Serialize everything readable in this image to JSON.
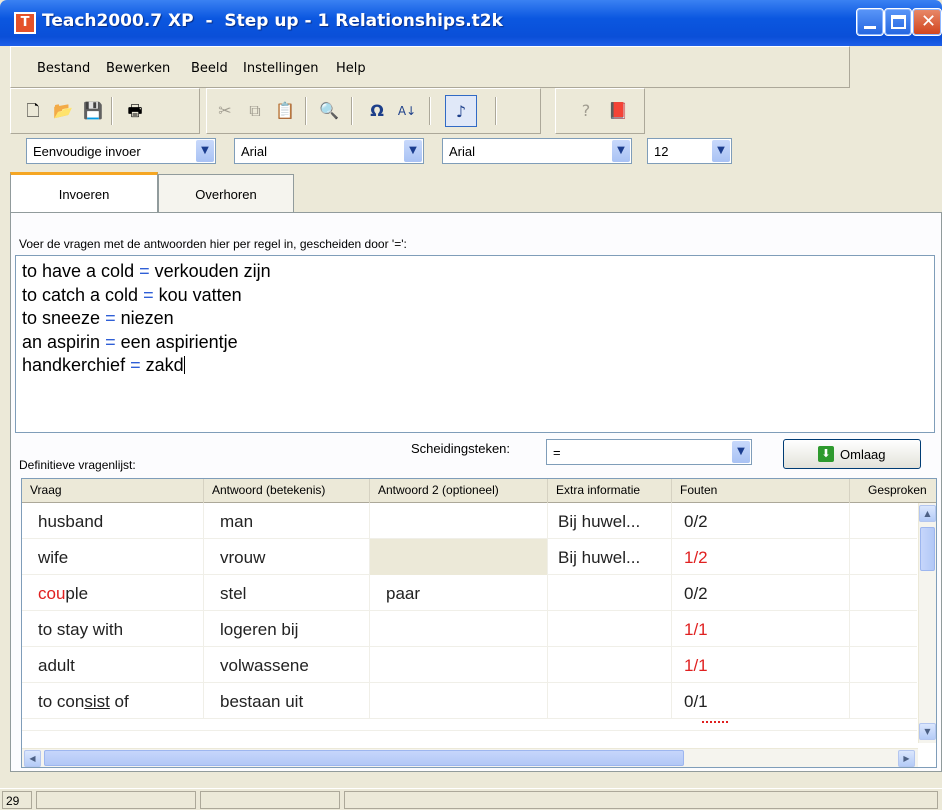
{
  "window": {
    "icon_letter": "T",
    "title": "Teach2000.7 XP  -  Step up - 1 Relationships.t2k"
  },
  "menu": [
    "Bestand",
    "Bewerken",
    "Beeld",
    "Instellingen",
    "Help"
  ],
  "toolbar": {
    "icons": [
      "new-icon",
      "open-icon",
      "save-icon",
      "print-icon",
      "cut-icon",
      "copy-icon",
      "paste-icon",
      "find-icon",
      "omega-icon",
      "sort-icon",
      "sound-icon",
      "help-icon",
      "book-icon"
    ]
  },
  "format": {
    "mode": "Eenvoudige invoer",
    "font1": "Arial",
    "font2": "Arial",
    "size": "12"
  },
  "tabs": [
    {
      "label": "Invoeren",
      "active": true
    },
    {
      "label": "Overhoren",
      "active": false
    }
  ],
  "entry": {
    "instruction": "Voer de vragen met de antwoorden hier per regel in, gescheiden door '=':",
    "lines": [
      {
        "q": "to have a cold ",
        "sep": "=",
        "a": " verkouden zijn"
      },
      {
        "q": "to catch a cold ",
        "sep": "=",
        "a": " kou vatten"
      },
      {
        "q": "to sneeze ",
        "sep": "=",
        "a": " niezen"
      },
      {
        "q": "an aspirin ",
        "sep": "=",
        "a": " een aspirientje"
      },
      {
        "q": "handkerchief ",
        "sep": "=",
        "a": " zakd"
      }
    ]
  },
  "separator": {
    "label": "Scheidingsteken:",
    "value": "="
  },
  "omlaag_label": "Omlaag",
  "list": {
    "label": "Definitieve vragenlijst:",
    "columns": [
      "Vraag",
      "Antwoord (betekenis)",
      "Antwoord 2 (optioneel)",
      "Extra informatie",
      "Fouten",
      "Gesproken"
    ],
    "rows": [
      {
        "vraag": "husband",
        "antwoord": "man",
        "antwoord2": "",
        "extra": "Bij huwel...",
        "fouten": "0/2",
        "fouten_red": false
      },
      {
        "vraag": "wife",
        "antwoord": "vrouw",
        "antwoord2": "",
        "extra": "Bij huwel...",
        "fouten": "1/2",
        "fouten_red": true
      },
      {
        "vraag": "couple",
        "antwoord": "stel",
        "antwoord2": "paar",
        "extra": "",
        "fouten": "0/2",
        "fouten_red": false
      },
      {
        "vraag": "to stay with",
        "antwoord": "logeren bij",
        "antwoord2": "",
        "extra": "",
        "fouten": "1/1",
        "fouten_red": true
      },
      {
        "vraag": "adult",
        "antwoord": "volwassene",
        "antwoord2": "",
        "extra": "",
        "fouten": "1/1",
        "fouten_red": true
      },
      {
        "vraag": "to consist of",
        "antwoord": "bestaan uit",
        "antwoord2": "",
        "extra": "",
        "fouten": "0/1",
        "fouten_red": false
      }
    ]
  },
  "status": {
    "count": "29"
  },
  "colors": {
    "title_blue": "#0b57e0",
    "error_red": "#e02020",
    "tab_accent": "#f5a623"
  }
}
